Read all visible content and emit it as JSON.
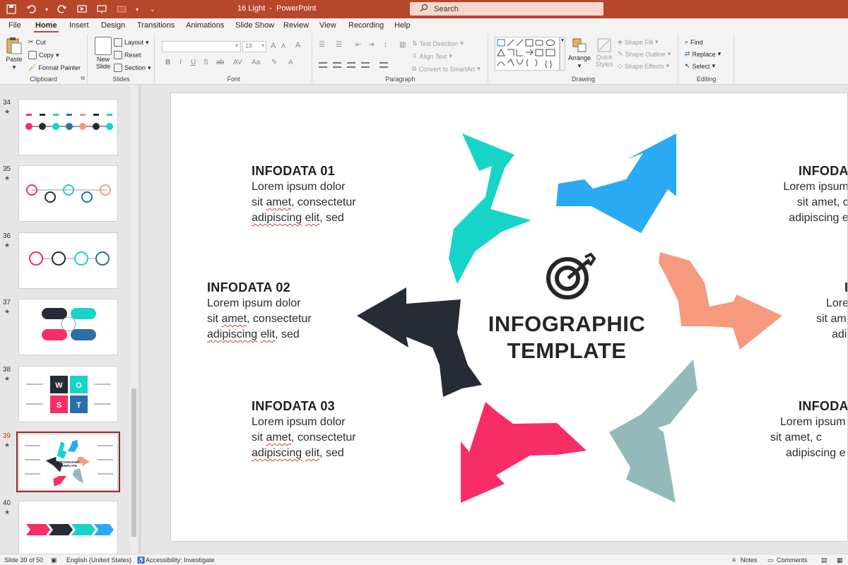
{
  "window": {
    "title": "16 Light  -  PowerPoint",
    "search_placeholder": "Search"
  },
  "tabs": [
    "File",
    "Home",
    "Insert",
    "Design",
    "Transitions",
    "Animations",
    "Slide Show",
    "Review",
    "View",
    "Recording",
    "Help"
  ],
  "active_tab": "Home",
  "ribbon": {
    "clipboard": {
      "label": "Clipboard",
      "paste": "Paste",
      "cut": "Cut",
      "copy": "Copy",
      "format_painter": "Format Painter"
    },
    "slides": {
      "label": "Slides",
      "new_slide": "New Slide",
      "layout": "Layout",
      "reset": "Reset",
      "section": "Section"
    },
    "font": {
      "label": "Font",
      "size": "18"
    },
    "paragraph": {
      "label": "Paragraph",
      "text_direction": "Text Direction",
      "align_text": "Align Text",
      "convert": "Convert to SmartArt"
    },
    "drawing": {
      "label": "Drawing",
      "arrange": "Arrange",
      "quick_styles": "Quick Styles",
      "shape_fill": "Shape Fill",
      "shape_outline": "Shape Outline",
      "shape_effects": "Shape Effects"
    },
    "editing": {
      "label": "Editing",
      "find": "Find",
      "replace": "Replace",
      "select": "Select"
    }
  },
  "thumbnails": [
    {
      "num": "34",
      "mark": "★",
      "selected": false
    },
    {
      "num": "35",
      "mark": "★",
      "selected": false
    },
    {
      "num": "36",
      "mark": "★",
      "selected": false
    },
    {
      "num": "37",
      "mark": "★",
      "selected": false
    },
    {
      "num": "38",
      "mark": "★",
      "selected": false
    },
    {
      "num": "39",
      "mark": "★",
      "selected": true
    },
    {
      "num": "40",
      "mark": "★",
      "selected": false
    }
  ],
  "thumb_texts": {
    "wost": [
      "W",
      "O",
      "S",
      "T"
    ],
    "infographic": "INFOGRAPHIC",
    "template": "TEMPLATE"
  },
  "slide": {
    "center_title_1": "INFOGRAPHIC",
    "center_title_2": "TEMPLATE",
    "blocks_left": [
      {
        "title": "INFODATA 01",
        "l1": "Lorem ipsum dolor",
        "l2a": "sit ",
        "l2b": "amet",
        "l2c": ", consectetur",
        "l3a": "adipiscing",
        "l3b": " ",
        "l3c": "elit",
        "l3d": ", sed"
      },
      {
        "title": "INFODATA 02",
        "l1": "Lorem ipsum dolor",
        "l2a": "sit ",
        "l2b": "amet",
        "l2c": ", consectetur",
        "l3a": "adipiscing",
        "l3b": " ",
        "l3c": "elit",
        "l3d": ", sed"
      },
      {
        "title": "INFODATA 03",
        "l1": "Lorem ipsum dolor",
        "l2a": "sit ",
        "l2b": "amet",
        "l2c": ", consectetur",
        "l3a": "adipiscing",
        "l3b": " ",
        "l3c": "elit",
        "l3d": ", sed"
      }
    ],
    "blocks_right": [
      {
        "title": "INFODA",
        "l1": "Lorem ipsum",
        "l2": "sit amet, c",
        "l3": "adipiscing e"
      },
      {
        "title": "I",
        "l1": "Lore",
        "l2": "sit am",
        "l3": "adi"
      },
      {
        "title": "INFODA",
        "l1": "Lorem ipsum",
        "l2": "sit amet, c",
        "l3": "adipiscing e"
      }
    ],
    "colors": {
      "teal": "#17d4c8",
      "blue": "#2aaaf5",
      "salmon": "#f69a7e",
      "grey_teal": "#94b9bb",
      "pink": "#f72d66",
      "dark": "#262b35"
    }
  },
  "status": {
    "slide": "Slide 39 of 50",
    "language": "English (United States)",
    "accessibility": "Accessibility: Investigate",
    "notes": "Notes",
    "comments": "Comments"
  }
}
